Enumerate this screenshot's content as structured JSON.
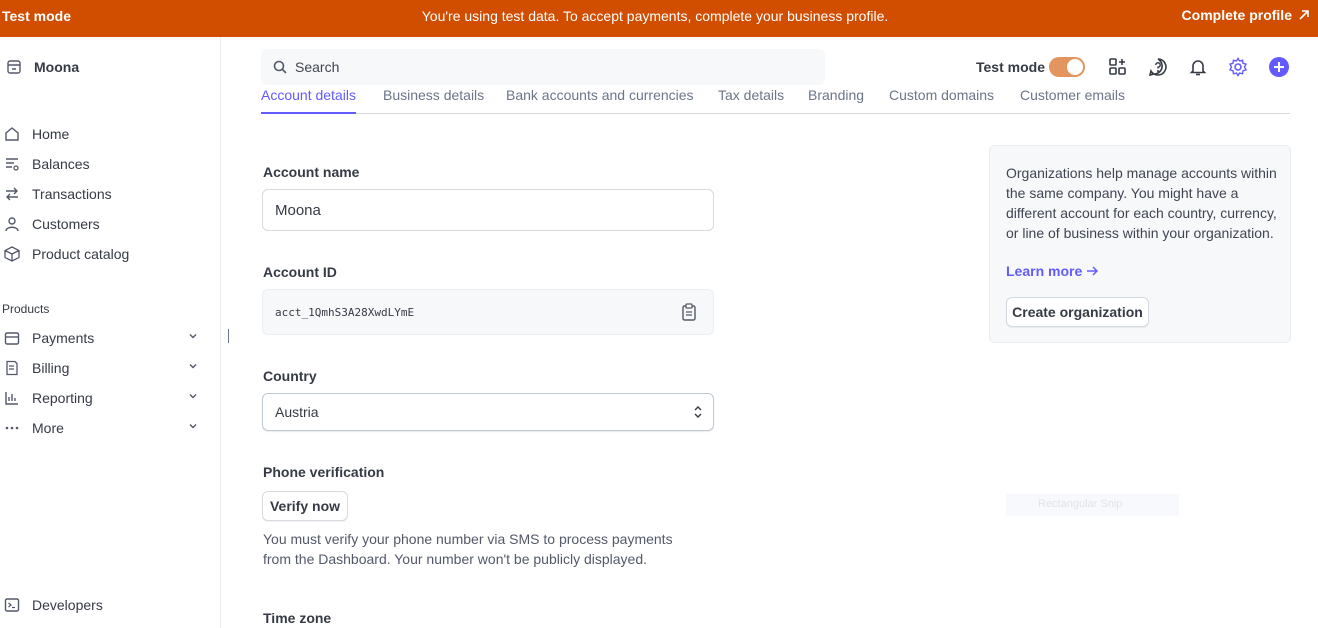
{
  "banner": {
    "mode": "Test mode",
    "message": "You're using test data. To accept payments, complete your business profile.",
    "cta": "Complete profile"
  },
  "sidebar": {
    "account": "Moona",
    "items": [
      {
        "label": "Home",
        "icon": "home-icon"
      },
      {
        "label": "Balances",
        "icon": "balances-icon"
      },
      {
        "label": "Transactions",
        "icon": "transactions-icon"
      },
      {
        "label": "Customers",
        "icon": "customers-icon"
      },
      {
        "label": "Product catalog",
        "icon": "product-catalog-icon"
      }
    ],
    "products_label": "Products",
    "products": [
      {
        "label": "Payments",
        "icon": "payments-icon"
      },
      {
        "label": "Billing",
        "icon": "billing-icon"
      },
      {
        "label": "Reporting",
        "icon": "reporting-icon"
      },
      {
        "label": "More",
        "icon": "more-icon"
      }
    ],
    "developers": "Developers"
  },
  "header": {
    "search_placeholder": "Search",
    "test_mode_label": "Test mode",
    "test_mode_on": true
  },
  "tabs": [
    "Account details",
    "Business details",
    "Bank accounts and currencies",
    "Tax details",
    "Branding",
    "Custom domains",
    "Customer emails"
  ],
  "active_tab": "Account details",
  "form": {
    "account_name_label": "Account name",
    "account_name_value": "Moona",
    "account_id_label": "Account ID",
    "account_id_value": "acct_1QmhS3A28XwdLYmE",
    "country_label": "Country",
    "country_value": "Austria",
    "phone_label": "Phone verification",
    "verify_button": "Verify now",
    "phone_help": "You must verify your phone number via SMS to process payments from the Dashboard. Your number won't be publicly displayed.",
    "timezone_label": "Time zone"
  },
  "info_card": {
    "text": "Organizations help manage accounts within the same company. You might have a different account for each country, currency, or line of business within your organization.",
    "learn_more": "Learn more",
    "button": "Create organization"
  },
  "overlay_text": "Rectangular Snip",
  "colors": {
    "banner": "#d14d00",
    "accent": "#635bff",
    "toggle": "#e2955f"
  }
}
